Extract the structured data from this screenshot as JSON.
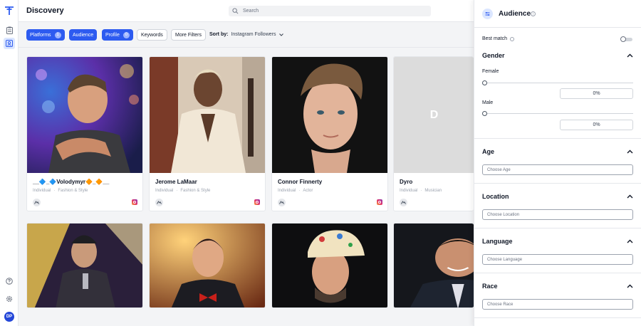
{
  "header": {
    "title": "Discovery",
    "search_placeholder": "Search"
  },
  "filters": {
    "chips": [
      {
        "label": "Platforms",
        "count": "1",
        "style": "primary"
      },
      {
        "label": "Audience",
        "count": "",
        "style": "primary"
      },
      {
        "label": "Profile",
        "count": "0",
        "style": "primary"
      },
      {
        "label": "Keywords",
        "count": "",
        "style": "outline"
      },
      {
        "label": "More Filters",
        "count": "",
        "style": "outline"
      }
    ],
    "sort_label": "Sort by:",
    "sort_value": "Instagram Followers"
  },
  "cards": [
    {
      "name": "__🔷_🔷Volodymyr🔶_🔶__",
      "type": "Individual",
      "category": "Fashion & Style",
      "platform": "instagram"
    },
    {
      "name": "Jerome LaMaar",
      "type": "Individual",
      "category": "Fashion & Style",
      "platform": "instagram"
    },
    {
      "name": "Connor Finnerty",
      "type": "Individual",
      "category": "Actor",
      "platform": "instagram"
    },
    {
      "name": "Dyro",
      "type": "Individual",
      "category": "Musician",
      "platform": "instagram",
      "initial": "D"
    }
  ],
  "panel": {
    "title": "Audience",
    "best_match_label": "Best match",
    "best_match_enabled": false,
    "gender": {
      "title": "Gender",
      "female_label": "Female",
      "female_value": "0%",
      "male_label": "Male",
      "male_value": "0%"
    },
    "age": {
      "title": "Age",
      "placeholder": "Choose Age"
    },
    "location": {
      "title": "Location",
      "placeholder": "Choose Location"
    },
    "language": {
      "title": "Language",
      "placeholder": "Choose Language"
    },
    "race": {
      "title": "Race",
      "placeholder": "Choose Race"
    }
  },
  "user": {
    "initials": "DP"
  },
  "colors": {
    "accent": "#2d5bf0",
    "instagram": "#e1306c"
  }
}
